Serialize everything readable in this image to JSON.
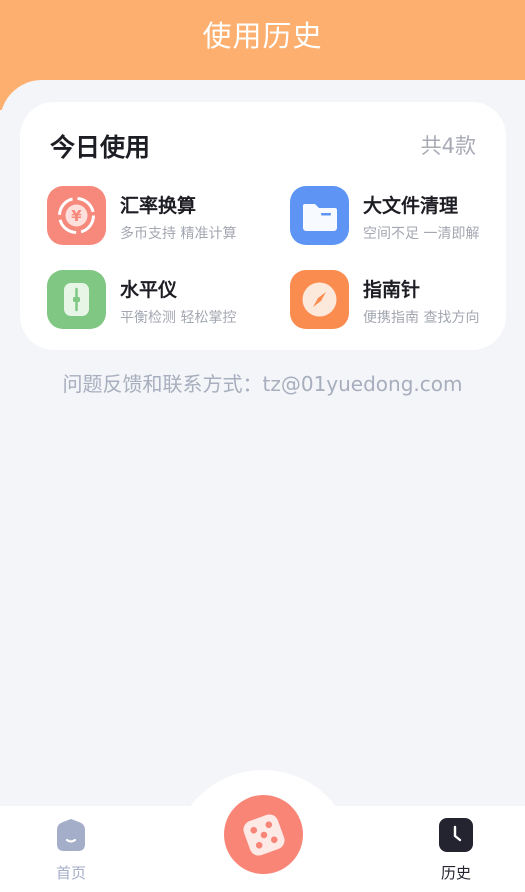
{
  "header": {
    "title": "使用历史"
  },
  "today": {
    "title": "今日使用",
    "count": "共4款",
    "tools": [
      {
        "name": "汇率换算",
        "desc": "多币支持 精准计算",
        "icon": "currency-exchange-icon",
        "color": "#f6897b"
      },
      {
        "name": "大文件清理",
        "desc": "空间不足 一清即解",
        "icon": "folder-icon",
        "color": "#5e95f5"
      },
      {
        "name": "水平仪",
        "desc": "平衡检测 轻松掌控",
        "icon": "level-icon",
        "color": "#7fc783"
      },
      {
        "name": "指南针",
        "desc": "便携指南 查找方向",
        "icon": "compass-icon",
        "color": "#fb8c4f"
      }
    ]
  },
  "feedback": {
    "text": "问题反馈和联系方式：tz@01yuedong.com"
  },
  "tabbar": {
    "home_label": "首页",
    "history_label": "历史",
    "center_icon": "dice-icon",
    "home_color": "#a5aec8",
    "history_color": "#232430"
  }
}
